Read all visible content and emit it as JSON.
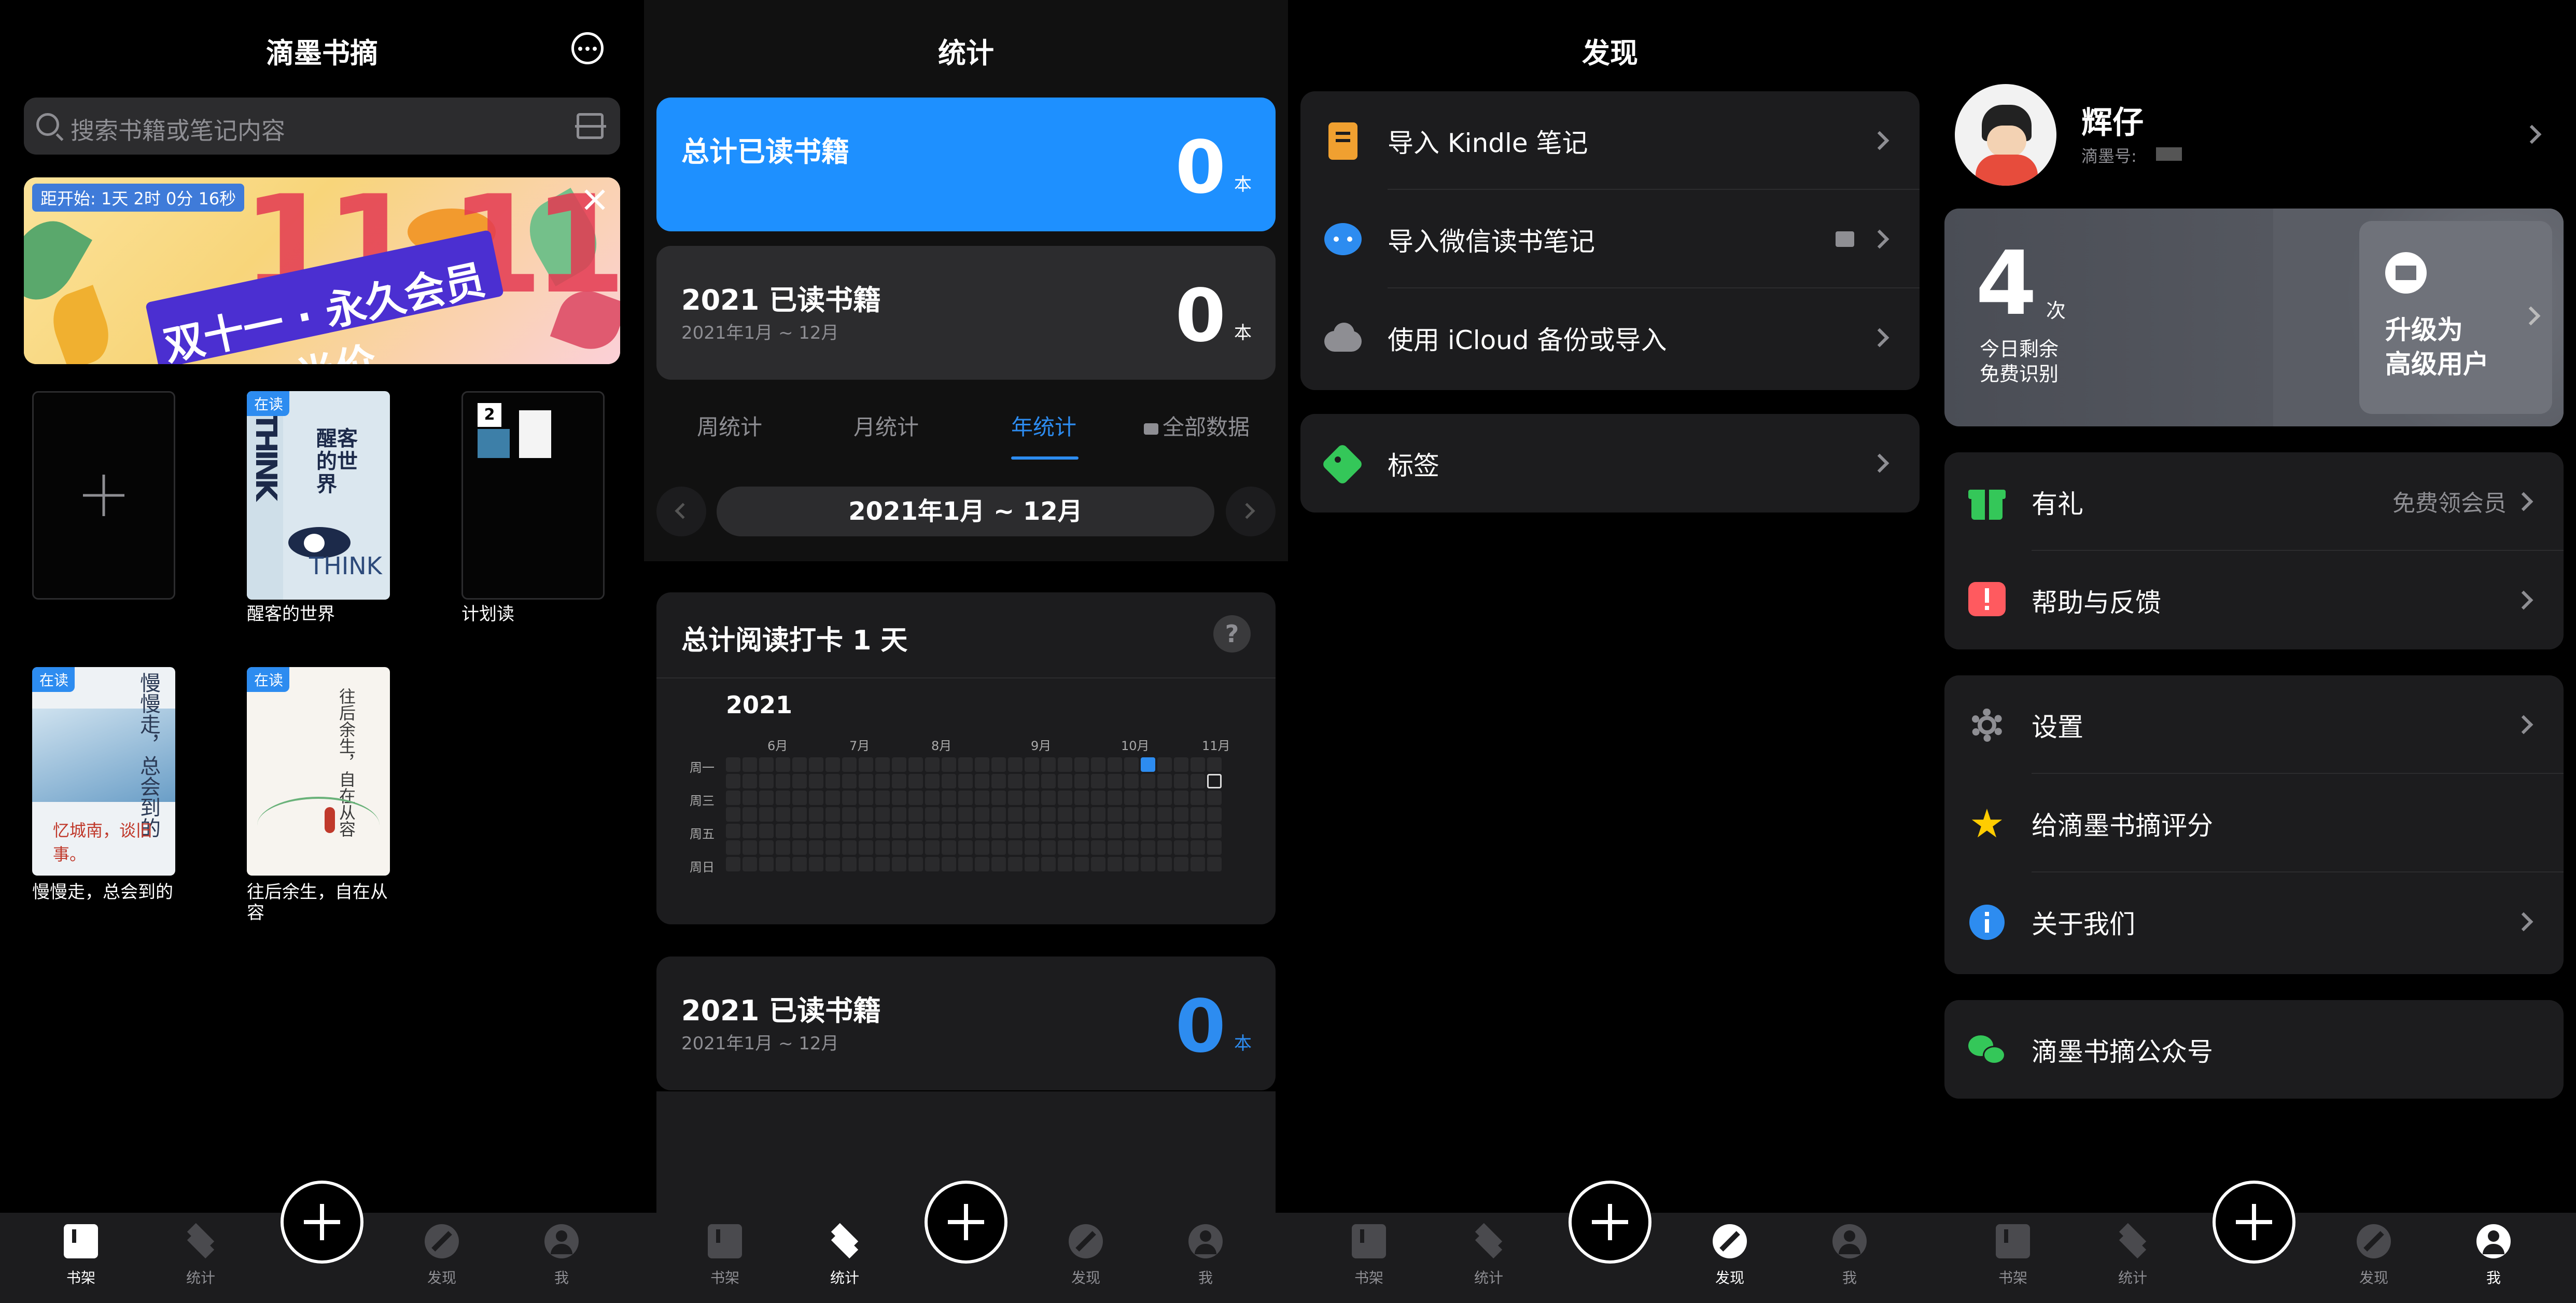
{
  "panel1": {
    "title": "滴墨书摘",
    "search_placeholder": "搜索书籍或笔记内容",
    "banner": {
      "countdown": "距开始: 1天 2时 0分 16秒",
      "big_text": "11.11",
      "ribbon": "双十一 · 永久会员半价"
    },
    "books": [
      {
        "label": "醒客的世界",
        "badge": "在读",
        "cover_title": "醒客的世界",
        "cover_text": "THINK"
      },
      {
        "label": "计划读",
        "badge": "",
        "count": "2"
      },
      {
        "label": "慢慢走，总会到的",
        "badge": "在读",
        "cover_title": "慢慢走，总会到的",
        "cover_sub": "忆城南，谈旧事。"
      },
      {
        "label": "往后余生，自在从容",
        "badge": "在读",
        "cover_title": "往后余生，自在从容"
      }
    ]
  },
  "panel2": {
    "title": "统计",
    "total": {
      "label": "总计已读书籍",
      "value": "0",
      "unit": "本"
    },
    "year": {
      "label": "2021 已读书籍",
      "sub": "2021年1月 ~ 12月",
      "value": "0",
      "unit": "本"
    },
    "segments": [
      "周统计",
      "月统计",
      "年统计",
      "全部数据"
    ],
    "active_segment": 2,
    "date_range": "2021年1月 ~ 12月",
    "checkin": {
      "title": "总计阅读打卡 1 天",
      "year": "2021",
      "months": [
        "6月",
        "7月",
        "8月",
        "9月",
        "10月",
        "11月"
      ],
      "weekdays": [
        "周一",
        "周三",
        "周五",
        "周日"
      ],
      "accent": "#2d8cf0"
    },
    "year2": {
      "label": "2021 已读书籍",
      "sub": "2021年1月 ~ 12月",
      "value": "0",
      "unit": "本"
    }
  },
  "panel3": {
    "title": "发现",
    "items": [
      {
        "label": "导入 Kindle 笔记",
        "icon": "kindle-icon"
      },
      {
        "label": "导入微信读书笔记",
        "icon": "wechat-read-icon"
      },
      {
        "label": "使用 iCloud 备份或导入",
        "icon": "cloud-icon"
      }
    ],
    "tags_label": "标签"
  },
  "panel4": {
    "name": "辉仔",
    "id_label": "滴墨号:",
    "quota": {
      "value": "4",
      "unit": "次",
      "line1": "今日剩余",
      "line2": "免费识别"
    },
    "upgrade": {
      "line1": "升级为",
      "line2": "高级用户"
    },
    "group1": [
      {
        "label": "有礼",
        "value": "免费领会员"
      },
      {
        "label": "帮助与反馈",
        "value": ""
      }
    ],
    "group2": [
      {
        "label": "设置"
      },
      {
        "label": "给滴墨书摘评分"
      },
      {
        "label": "关于我们"
      }
    ],
    "official": "滴墨书摘公众号"
  },
  "tabbar": {
    "tabs": [
      "书架",
      "统计",
      "发现",
      "我"
    ]
  }
}
